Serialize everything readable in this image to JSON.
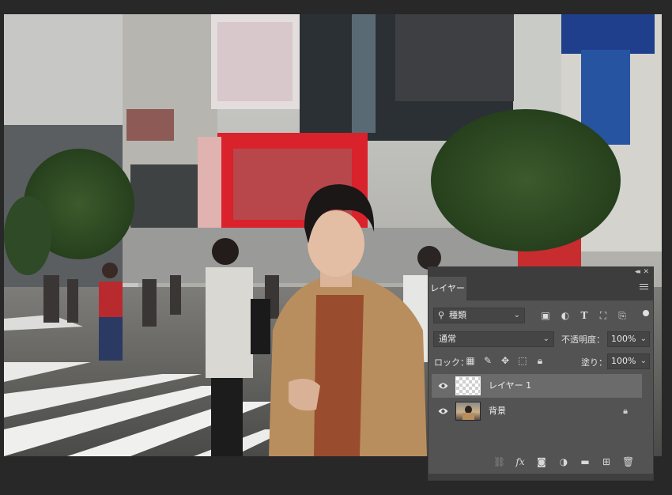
{
  "panel": {
    "tab_label": "レイヤー",
    "kind_filter": "種類",
    "blend_mode": "通常",
    "opacity_label": "不透明度：",
    "opacity_value": "100%",
    "lock_label": "ロック：",
    "fill_label": "塗り：",
    "fill_value": "100%",
    "layers": [
      {
        "name": "レイヤー 1",
        "selected": true,
        "visible": true,
        "locked": false
      },
      {
        "name": "背景",
        "selected": false,
        "visible": true,
        "locked": true
      }
    ]
  },
  "colors": {
    "app_background": "#282828",
    "panel_background": "#535353",
    "panel_header": "#3d3d3d",
    "selected_layer": "#6b6b6b",
    "field_background": "#454545"
  }
}
